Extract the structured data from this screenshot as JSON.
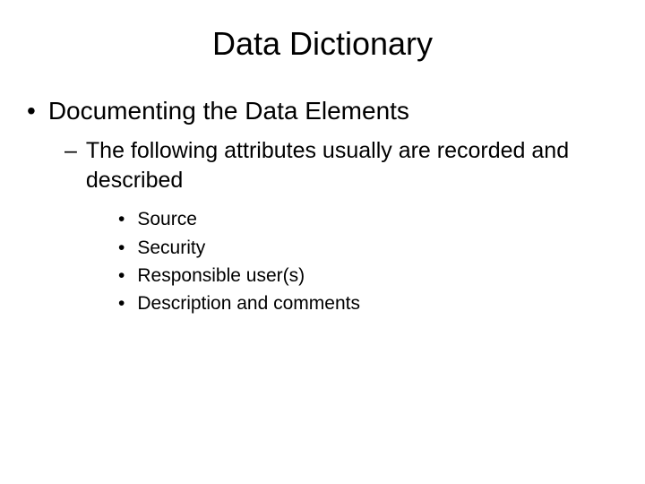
{
  "title": "Data Dictionary",
  "level1": {
    "text": "Documenting the Data Elements"
  },
  "level2": {
    "text": "The following attributes usually are recorded and described"
  },
  "level3": {
    "items": [
      "Source",
      "Security",
      "Responsible user(s)",
      "Description and comments"
    ]
  }
}
